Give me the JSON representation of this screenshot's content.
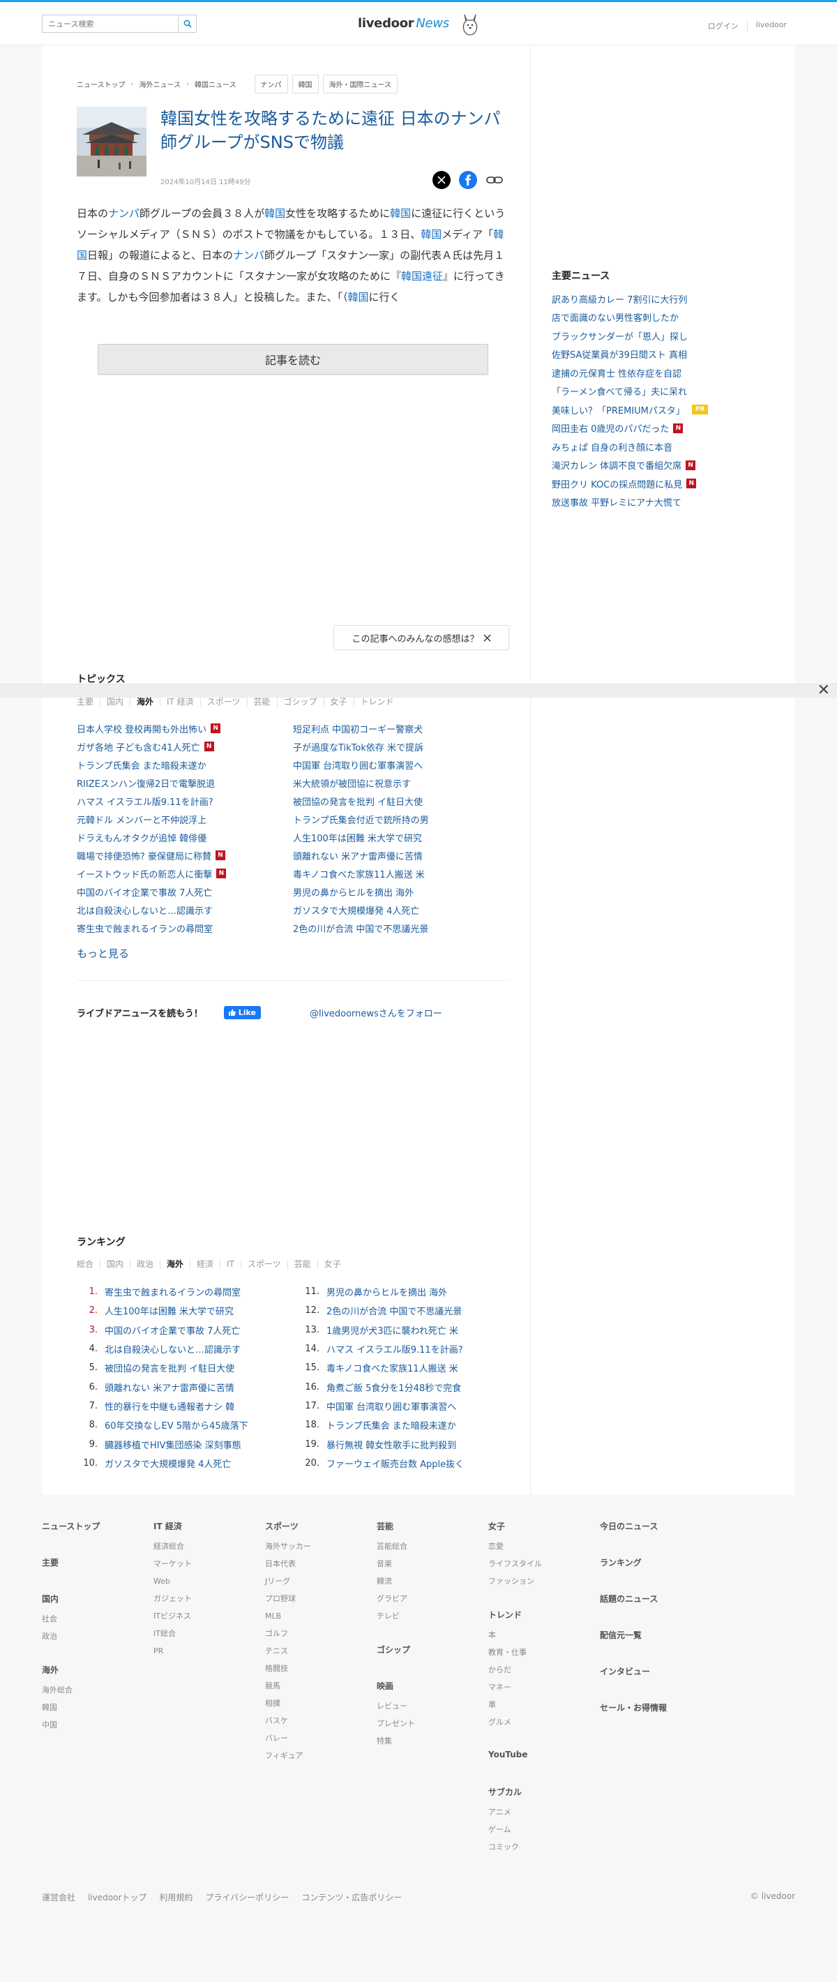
{
  "header": {
    "search_placeholder": "ニュース検索",
    "logo_text": "livedoor",
    "logo_news": "News",
    "links": [
      "ログイン",
      "livedoor"
    ]
  },
  "article": {
    "breadcrumbs": [
      "ニューストップ",
      "海外ニュース",
      "韓国ニュース"
    ],
    "tags": [
      "ナンパ",
      "韓国",
      "海外・国際ニュース"
    ],
    "title": "韓国女性を攻略するために遠征 日本のナンパ師グループがSNSで物議",
    "date": "2024年10月14日 11時49分",
    "body": [
      {
        "t": "日本の"
      },
      {
        "t": "ナンパ",
        "k": true
      },
      {
        "t": "師グループの会員３８人が"
      },
      {
        "t": "韓国",
        "k": true
      },
      {
        "t": "女性を攻略するために"
      },
      {
        "t": "韓国",
        "k": true
      },
      {
        "t": "に遠征に行くというソーシャルメディア（ＳＮＳ）のポストで物議をかもしている。１３日、"
      },
      {
        "t": "韓国",
        "k": true
      },
      {
        "t": "メディア「"
      },
      {
        "t": "韓国",
        "k": true
      },
      {
        "t": "日報」の報道によると、日本の"
      },
      {
        "t": "ナンパ",
        "k": true
      },
      {
        "t": "師グループ「スタナン一家」の副代表Ａ氏は先月１７日、自身のＳＮＳアカウントに「スタナン一家が女攻略のために『"
      },
      {
        "t": "韓国遠征",
        "k": true
      },
      {
        "t": "』に行ってきます。しかも今回参加者は３８人」と投稿した。また、「（"
      },
      {
        "t": "韓国",
        "k": true
      },
      {
        "t": "に行く"
      }
    ],
    "read_button": "記事を読む",
    "reaction": "この記事へのみんなの感想は？"
  },
  "sidebar": {
    "title": "主要ニュース",
    "items": [
      {
        "text": "訳あり高級カレー 7割引に大行列"
      },
      {
        "text": "店で面識のない男性客刺したか"
      },
      {
        "text": "ブラックサンダーが「恩人」探し"
      },
      {
        "text": "佐野SA従業員が39日間スト 真相"
      },
      {
        "text": "逮捕の元保育士 性依存症を自認"
      },
      {
        "text": "「ラーメン食べて帰る」夫に呆れ"
      },
      {
        "text": "美味しい？「PREMIUMパスタ」",
        "badge": "PR"
      },
      {
        "text": "岡田圭右 0歳児のパパだった",
        "badge": "N"
      },
      {
        "text": "みちょぱ 自身の利き顔に本音"
      },
      {
        "text": "滝沢カレン 体調不良で番組欠席",
        "badge": "N"
      },
      {
        "text": "野田クリ KOCの採点問題に私見",
        "badge": "N"
      },
      {
        "text": "放送事故 平野レミにアナ大慌て"
      }
    ]
  },
  "topics": {
    "title": "トピックス",
    "tabs": [
      "主要",
      "国内",
      "海外",
      "IT 経済",
      "スポーツ",
      "芸能",
      "ゴシップ",
      "女子",
      "トレンド"
    ],
    "active_tab": 2,
    "left": [
      {
        "text": "日本人学校 登校再開も外出怖い",
        "badge": "N"
      },
      {
        "text": "ガザ各地 子ども含む41人死亡",
        "badge": "N"
      },
      {
        "text": "トランプ氏集会 また暗殺未遂か"
      },
      {
        "text": "RIIZEスンハン復帰2日で電撃脱退"
      },
      {
        "text": "ハマス イスラエル版9.11を計画?"
      },
      {
        "text": "元韓ドル メンバーと不仲説浮上"
      },
      {
        "text": "ドラえもんオタクが追悼 韓俳優"
      },
      {
        "text": "職場で排便恐怖? 豪保健局に称賛",
        "badge": "N"
      },
      {
        "text": "イーストウッド氏の新恋人に衝撃",
        "badge": "N"
      },
      {
        "text": "中国のバイオ企業で事故 7人死亡"
      },
      {
        "text": "北は自殺決心しないと…認識示す"
      },
      {
        "text": "寄生虫で蝕まれるイランの尋問室"
      }
    ],
    "right": [
      {
        "text": "短足利点 中国初コーギー警察犬"
      },
      {
        "text": "子が過度なTikTok依存 米で提訴"
      },
      {
        "text": "中国軍 台湾取り囲む軍事演習へ"
      },
      {
        "text": "米大統領が被団協に祝意示す"
      },
      {
        "text": "被団協の発言を批判 イ駐日大使"
      },
      {
        "text": "トランプ氏集会付近で銃所持の男"
      },
      {
        "text": "人生100年は困難 米大学で研究"
      },
      {
        "text": "頭離れない 米アナ雷声優に苦情"
      },
      {
        "text": "毒キノコ食べた家族11人搬送 米"
      },
      {
        "text": "男児の鼻からヒルを摘出 海外"
      },
      {
        "text": "ガソスタで大規模爆発 4人死亡"
      },
      {
        "text": "2色の川が合流 中国で不思議光景"
      }
    ],
    "more": "もっと見る"
  },
  "follow": {
    "label": "ライブドアニュースを読もう！",
    "like": "Like",
    "twitter": "@livedoornewsさんをフォロー"
  },
  "ranking": {
    "title": "ランキング",
    "tabs": [
      "総合",
      "国内",
      "政治",
      "海外",
      "経済",
      "IT",
      "スポーツ",
      "芸能",
      "女子"
    ],
    "active_tab": 3,
    "items": [
      "寄生虫で蝕まれるイランの尋問室",
      "人生100年は困難 米大学で研究",
      "中国のバイオ企業で事故 7人死亡",
      "北は自殺決心しないと…認識示す",
      "被団協の発言を批判 イ駐日大使",
      "頭離れない 米アナ雷声優に苦情",
      "性的暴行を中継も通報者ナシ 韓",
      "60年交換なしEV 5階から45歳落下",
      "臓器移植でHIV集団感染 深刻事態",
      "ガソスタで大規模爆発 4人死亡",
      "男児の鼻からヒルを摘出 海外",
      "2色の川が合流 中国で不思議光景",
      "1歳男児が犬3匹に襲われ死亡 米",
      "ハマス イスラエル版9.11を計画?",
      "毒キノコ食べた家族11人搬送 米",
      "角煮ご飯 5食分を1分48秒で完食",
      "中国軍 台湾取り囲む軍事演習へ",
      "トランプ氏集会 また暗殺未遂か",
      "暴行無視 韓女性歌手に批判殺到",
      "ファーウェイ販売台数 Apple抜く"
    ]
  },
  "footer": {
    "cols": [
      [
        {
          "h": "ニューストップ"
        },
        {
          "h": "主要"
        },
        {
          "h": "国内"
        },
        {
          "s": "社会"
        },
        {
          "s": "政治"
        },
        {
          "h": "海外"
        },
        {
          "s": "海外総合"
        },
        {
          "s": "韓国"
        },
        {
          "s": "中国"
        }
      ],
      [
        {
          "h": "IT 経済"
        },
        {
          "s": "経済総合"
        },
        {
          "s": "マーケット"
        },
        {
          "s": "Web"
        },
        {
          "s": "ガジェット"
        },
        {
          "s": "ITビジネス"
        },
        {
          "s": "IT総合"
        },
        {
          "s": "PR"
        }
      ],
      [
        {
          "h": "スポーツ"
        },
        {
          "s": "海外サッカー"
        },
        {
          "s": "日本代表"
        },
        {
          "s": "Jリーグ"
        },
        {
          "s": "プロ野球"
        },
        {
          "s": "MLB"
        },
        {
          "s": "ゴルフ"
        },
        {
          "s": "テニス"
        },
        {
          "s": "格闘技"
        },
        {
          "s": "競馬"
        },
        {
          "s": "相撲"
        },
        {
          "s": "バスケ"
        },
        {
          "s": "バレー"
        },
        {
          "s": "フィギュア"
        }
      ],
      [
        {
          "h": "芸能"
        },
        {
          "s": "芸能総合"
        },
        {
          "s": "音楽"
        },
        {
          "s": "韓流"
        },
        {
          "s": "グラビア"
        },
        {
          "s": "テレビ"
        },
        {
          "h": "ゴシップ"
        },
        {
          "h": "映画"
        },
        {
          "s": "レビュー"
        },
        {
          "s": "プレゼント"
        },
        {
          "s": "特集"
        }
      ],
      [
        {
          "h": "女子"
        },
        {
          "s": "恋愛"
        },
        {
          "s": "ライフスタイル"
        },
        {
          "s": "ファッション"
        },
        {
          "h": "トレンド"
        },
        {
          "s": "本"
        },
        {
          "s": "教育・仕事"
        },
        {
          "s": "からだ"
        },
        {
          "s": "マネー"
        },
        {
          "s": "車"
        },
        {
          "s": "グルメ"
        },
        {
          "h": "YouTube"
        },
        {
          "h": "サブカル"
        },
        {
          "s": "アニメ"
        },
        {
          "s": "ゲーム"
        },
        {
          "s": "コミック"
        }
      ],
      [
        {
          "h": "今日のニュース"
        },
        {
          "h": "ランキング"
        },
        {
          "h": "話題のニュース"
        },
        {
          "h": "配信元一覧"
        },
        {
          "h": "インタビュー"
        },
        {
          "h": "セール・お得情報"
        }
      ]
    ],
    "bottom_links": [
      "運営会社",
      "livedoorトップ",
      "利用規約",
      "プライバシーポリシー",
      "コンテンツ・広告ポリシー"
    ],
    "copyright": "© livedoor"
  },
  "colors": {
    "link": "#1a5b9c",
    "accent": "#1da1f2",
    "badge_new": "#c3121f",
    "badge_pr": "#f5c518"
  }
}
